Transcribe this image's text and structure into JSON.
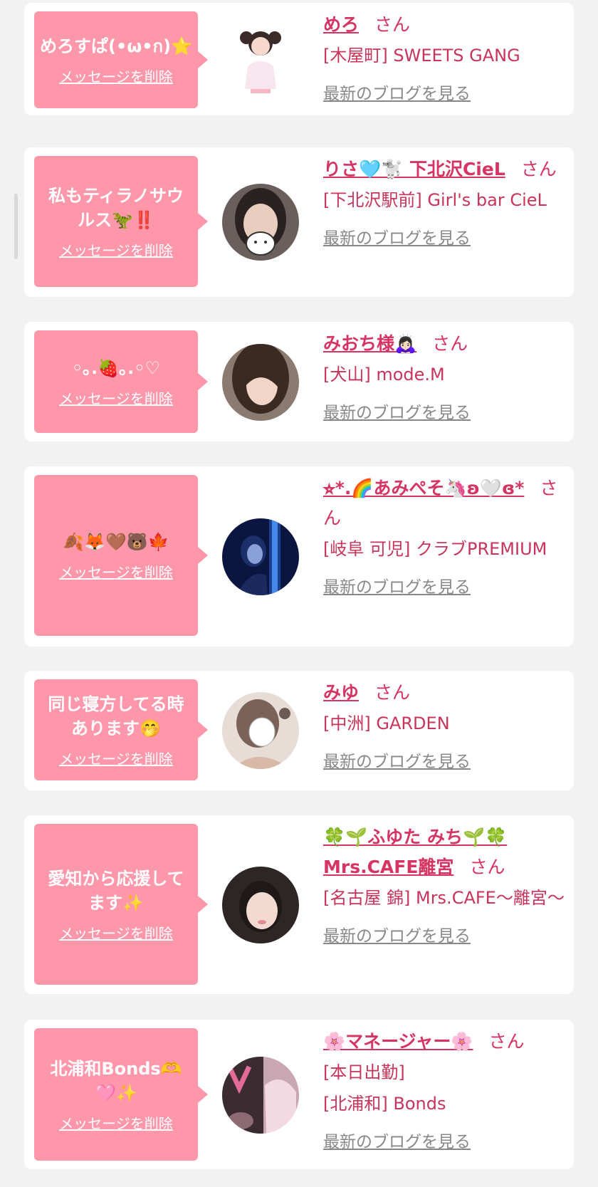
{
  "delete_label": "メッセージを削除",
  "blog_label": "最新のブログを見る",
  "honorific": "さん",
  "colors": {
    "bubble": "#ff97ab",
    "name": "#d63462",
    "shop": "#c8345a",
    "link_gray": "#888888",
    "background": "#f2f2f2"
  },
  "cards": [
    {
      "message": "めろすぱ(•ω•ก)⭐",
      "name": "めろ",
      "shop": "[木屋町] SWEETS GANG",
      "avatar": "idol-girl-photo"
    },
    {
      "message": "私もティラノサウルス🦖‼️",
      "name": "りさ🩵🐩 下北沢CieL",
      "shop": "[下北沢駅前] Girl's bar CieL",
      "avatar": "selfie-with-sticker-photo"
    },
    {
      "message": "◦｡.🍓｡.◦♡",
      "name": "みおち様🙇🏻‍♀️",
      "shop": "[犬山] mode.M",
      "avatar": "portrait-photo"
    },
    {
      "message": "🍂🦊🤎🐻🍁",
      "name": "⭐︎*.🌈あみぺそ🦄ʚ🤍ɞ*",
      "shop": "[岐阜 可児] クラブPREMIUM",
      "avatar": "blue-neon-photo"
    },
    {
      "message": "同じ寝方してる時あります🤭",
      "name": "みゆ",
      "shop": "[中洲] GARDEN",
      "avatar": "masked-photo"
    },
    {
      "message": "愛知から応援してます✨",
      "name": "🍀🌱ふゆた みち🌱🍀Mrs.CAFE離宮",
      "shop": "[名古屋 錦] Mrs.CAFE～離宮～",
      "avatar": "selfie-photo"
    },
    {
      "message": "北浦和Bonds🫶🩷✨",
      "name": "🌸マネージャー🌸",
      "shop": "[本日出勤]",
      "shop2": "[北浦和] Bonds",
      "avatar": "bonds-logo-photo"
    }
  ]
}
